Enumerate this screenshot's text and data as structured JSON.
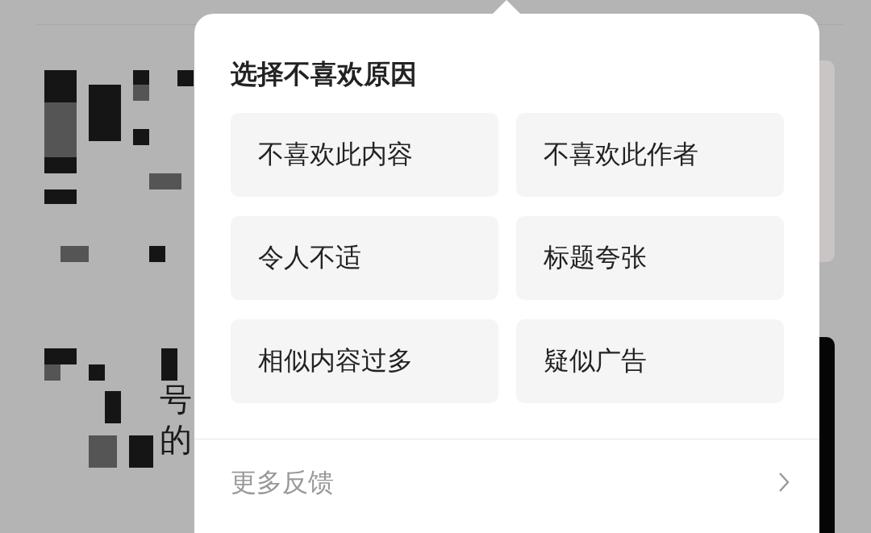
{
  "background_feed": {
    "fragments": [
      {
        "text": "号"
      },
      {
        "text": "的"
      }
    ]
  },
  "popup": {
    "title": "选择不喜欢原因",
    "reasons": [
      {
        "label": "不喜欢此内容"
      },
      {
        "label": "不喜欢此作者"
      },
      {
        "label": "令人不适"
      },
      {
        "label": "标题夸张"
      },
      {
        "label": "相似内容过多"
      },
      {
        "label": "疑似广告"
      }
    ],
    "more": {
      "label": "更多反馈"
    }
  }
}
